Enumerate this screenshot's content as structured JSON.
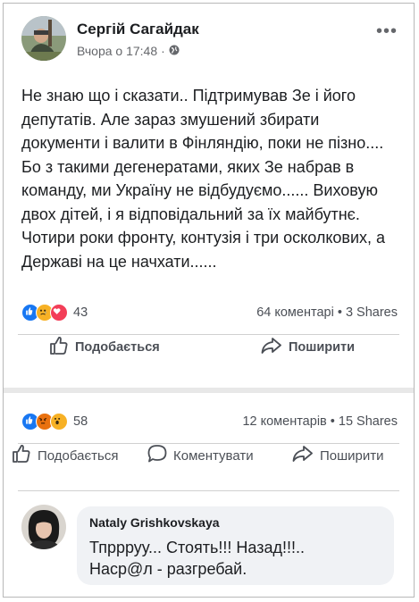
{
  "post": {
    "author": "Сергій Сагайдак",
    "time": "Вчора о 17:48",
    "separator": "·",
    "privacy_icon": "globe-icon",
    "more_icon": "more-dots-icon",
    "text": "Не знаю що і сказати.. Підтримував Зе і його депутатів. Але зараз змушений збирати документи і валити в Фінляндію, поки не пізно.... Бо з такими дегенератами, яких Зе набрав в команду, ми Україну не відбудуємо...... Виховую двох дітей, і я відповідальний за їх майбутнє. Чотири роки фронту, контузія і три осколкових, а Державі на це начхати......",
    "reactions": {
      "icons": [
        "like-icon",
        "sad-icon",
        "love-icon"
      ],
      "count": "43",
      "comments": "64 коментарі",
      "dot": "•",
      "shares": "3 Shares"
    },
    "actions": {
      "like": "Подобається",
      "share": "Поширити"
    }
  },
  "second_post": {
    "reactions": {
      "icons": [
        "like-icon",
        "angry-icon",
        "wow-icon"
      ],
      "count": "58",
      "comments": "12 коментарів",
      "dot": "•",
      "shares": "15 Shares"
    },
    "actions": {
      "like": "Подобається",
      "comment": "Коментувати",
      "share": "Поширити"
    }
  },
  "comment": {
    "author": "Nataly Grishkovskaya",
    "text": "Тпррруу... Стоять!!!   Назад!!!..\nНаср@л - разгребай."
  },
  "colors": {
    "like": "#1877f2",
    "love": "#f33e58",
    "sad": "#f7b125",
    "angry": "#e9710f",
    "text": "#1c1e21",
    "muted": "#65676b",
    "bubble": "#f0f2f5"
  }
}
